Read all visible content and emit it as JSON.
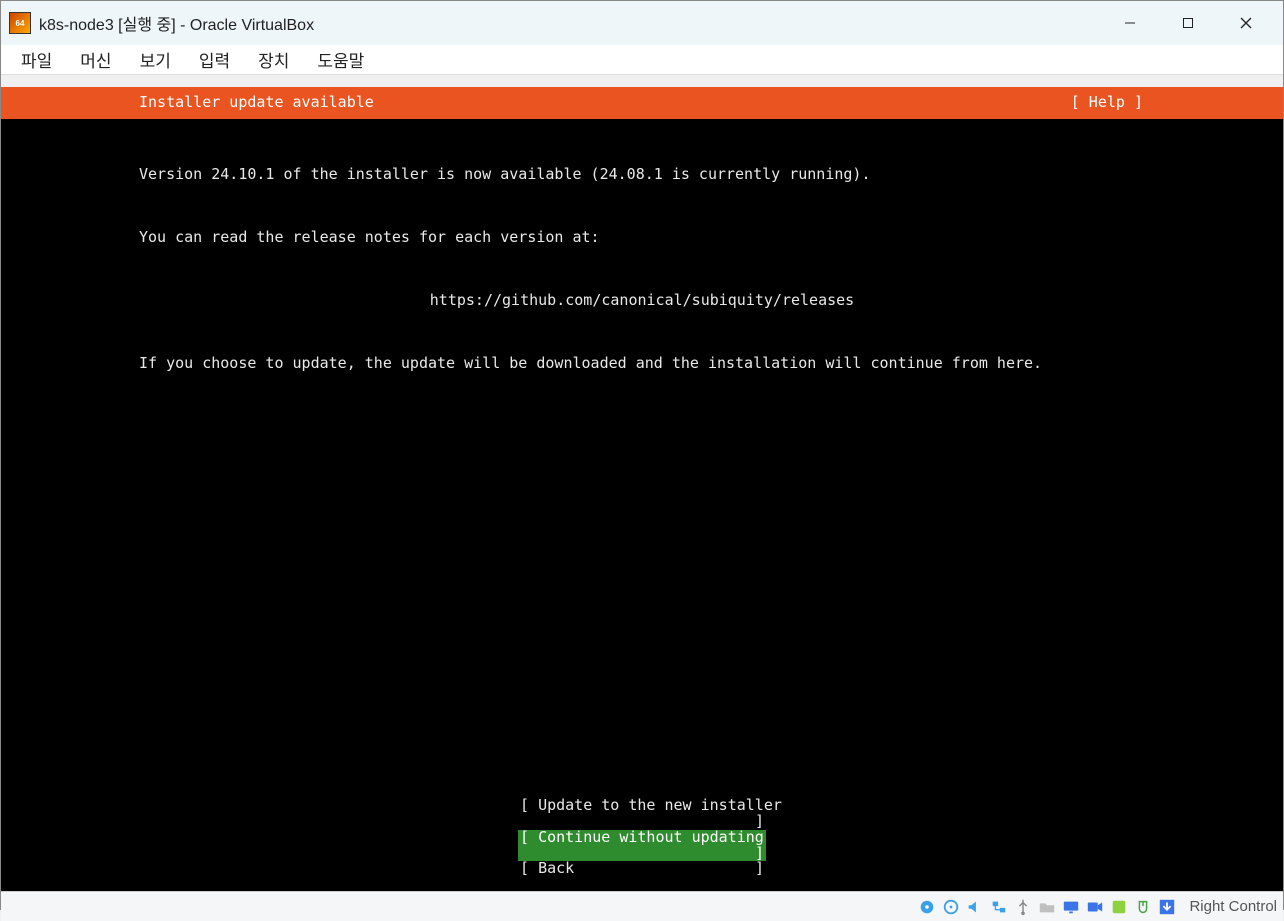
{
  "window": {
    "title": "k8s-node3 [실행 중] - Oracle VirtualBox",
    "icon_label": "64"
  },
  "menubar": {
    "items": [
      "파일",
      "머신",
      "보기",
      "입력",
      "장치",
      "도움말"
    ]
  },
  "installer": {
    "header_title": "Installer update available",
    "help_label": "[ Help ]",
    "line1": "Version 24.10.1 of the installer is now available (24.08.1 is currently running).",
    "line2": "You can read the release notes for each version at:",
    "link": "https://github.com/canonical/subiquity/releases",
    "line3": "If you choose to update, the update will be downloaded and the installation will continue from here.",
    "actions": {
      "update": "Update to the new installer",
      "continue": "Continue without updating",
      "back": "Back"
    }
  },
  "statusbar": {
    "host_key": "Right Control"
  },
  "colors": {
    "ubuntu_orange": "#e95420",
    "selected_green": "#2e8b2e"
  }
}
